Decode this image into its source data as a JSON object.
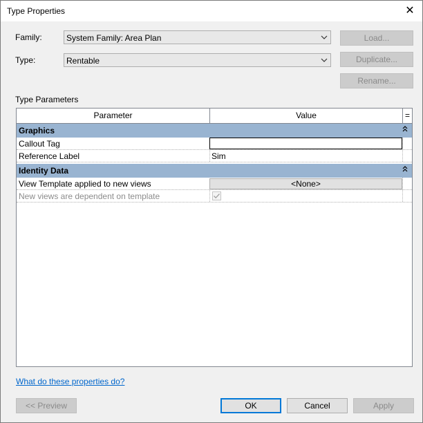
{
  "window": {
    "title": "Type Properties",
    "close_glyph": "✕"
  },
  "family": {
    "label": "Family:",
    "value": "System Family: Area Plan"
  },
  "type": {
    "label": "Type:",
    "value": "Rentable"
  },
  "buttons": {
    "load": "Load...",
    "duplicate": "Duplicate...",
    "rename": "Rename..."
  },
  "section_label": "Type Parameters",
  "table": {
    "headers": {
      "parameter": "Parameter",
      "value": "Value",
      "extra": "="
    },
    "groups": [
      {
        "name": "Graphics",
        "rows": [
          {
            "param": "Callout Tag",
            "value": ""
          },
          {
            "param": "Reference Label",
            "value": "Sim"
          }
        ]
      },
      {
        "name": "Identity Data",
        "rows": [
          {
            "param": "View Template applied to new views",
            "value": "<None>"
          },
          {
            "param": "New views are dependent on template",
            "value": "",
            "checked": true,
            "disabled": true
          }
        ]
      }
    ]
  },
  "help_link": "What do these properties do?",
  "footer": {
    "preview": "<< Preview",
    "ok": "OK",
    "cancel": "Cancel",
    "apply": "Apply"
  },
  "colors": {
    "group_header": "#99b4d1",
    "accent": "#0078d7",
    "link": "#0066cc"
  },
  "icons": {
    "close": "close-icon",
    "dropdown": "chevron-down-icon",
    "collapse": "collapse-icon",
    "checkbox": "checkbox-icon"
  }
}
